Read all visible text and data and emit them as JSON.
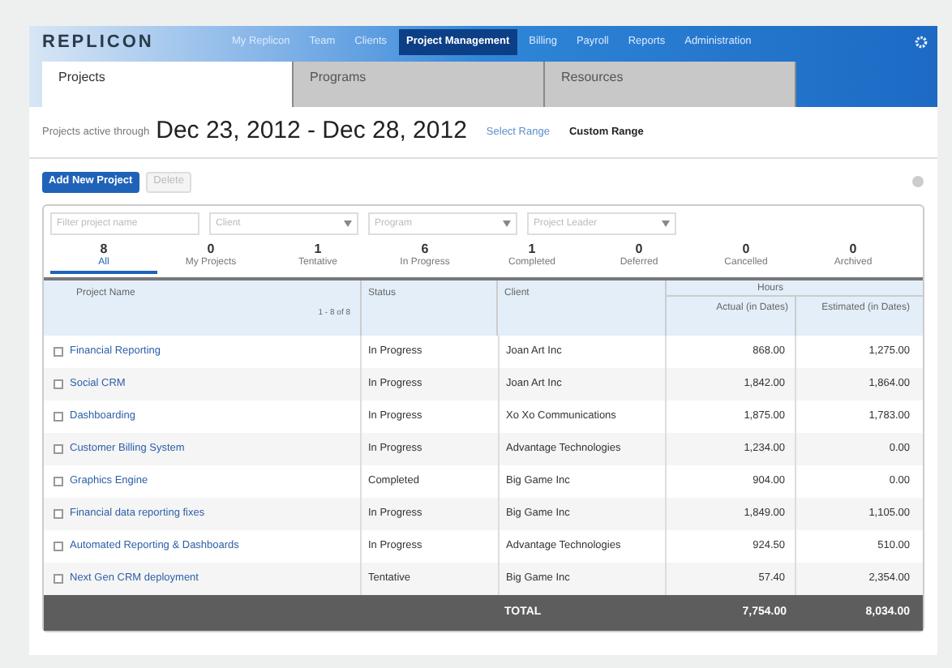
{
  "logo": "REPLICON",
  "nav": [
    {
      "label": "My Replicon",
      "selected": false
    },
    {
      "label": "Team",
      "selected": false
    },
    {
      "label": "Clients",
      "selected": false
    },
    {
      "label": "Project Management",
      "selected": true
    },
    {
      "label": "Billing",
      "selected": false
    },
    {
      "label": "Payroll",
      "selected": false
    },
    {
      "label": "Reports",
      "selected": false
    },
    {
      "label": "Administration",
      "selected": false
    }
  ],
  "tabs": [
    {
      "label": "Projects",
      "selected": true
    },
    {
      "label": "Programs",
      "selected": false
    },
    {
      "label": "Resources",
      "selected": false
    }
  ],
  "date_range": {
    "label": "Projects active through",
    "range": "Dec 23, 2012 - Dec 28, 2012",
    "links": [
      "Select Range",
      "Custom Range"
    ]
  },
  "actions": [
    {
      "label": "Add New Project",
      "disabled": false
    },
    {
      "label": "Delete",
      "disabled": true
    }
  ],
  "filters": [
    {
      "kind": "text",
      "placeholder": "Filter project name"
    },
    {
      "kind": "select",
      "placeholder": "Client"
    },
    {
      "kind": "select",
      "placeholder": "Program"
    },
    {
      "kind": "select",
      "placeholder": "Project Leader"
    }
  ],
  "status_tabs": [
    {
      "count": "8",
      "label": "All",
      "selected": true
    },
    {
      "count": "0",
      "label": "My Projects",
      "selected": false
    },
    {
      "count": "1",
      "label": "Tentative",
      "selected": false
    },
    {
      "count": "6",
      "label": "In Progress",
      "selected": false
    },
    {
      "count": "1",
      "label": "Completed",
      "selected": false
    },
    {
      "count": "0",
      "label": "Deferred",
      "selected": false
    },
    {
      "count": "0",
      "label": "Cancelled",
      "selected": false
    },
    {
      "count": "0",
      "label": "Archived",
      "selected": false
    }
  ],
  "table": {
    "columns": [
      "Project Name",
      "Status",
      "Client",
      "Actual (in Dates)",
      "Estimated (in Dates)"
    ],
    "group_header": "Hours",
    "pager": "1 - 8 of 8",
    "rows": [
      {
        "checked": false,
        "name": "Financial Reporting",
        "status": "In Progress",
        "client": "Joan Art Inc",
        "actual": "868.00",
        "estimated": "1,275.00"
      },
      {
        "checked": false,
        "name": "Social CRM",
        "status": "In Progress",
        "client": "Joan Art Inc",
        "actual": "1,842.00",
        "estimated": "1,864.00"
      },
      {
        "checked": false,
        "name": "Dashboarding",
        "status": "In Progress",
        "client": "Xo Xo Communications",
        "actual": "1,875.00",
        "estimated": "1,783.00"
      },
      {
        "checked": false,
        "name": "Customer Billing System",
        "status": "In Progress",
        "client": "Advantage Technologies",
        "actual": "1,234.00",
        "estimated": "0.00"
      },
      {
        "checked": false,
        "name": "Graphics Engine",
        "status": "Completed",
        "client": "Big Game Inc",
        "actual": "904.00",
        "estimated": "0.00"
      },
      {
        "checked": false,
        "name": "Financial data reporting fixes",
        "status": "In Progress",
        "client": "Big Game Inc",
        "actual": "1,849.00",
        "estimated": "1,105.00"
      },
      {
        "checked": false,
        "name": "Automated Reporting & Dashboards",
        "status": "In Progress",
        "client": "Advantage Technologies",
        "actual": "924.50",
        "estimated": "510.00"
      },
      {
        "checked": false,
        "name": "Next Gen CRM deployment",
        "status": "Tentative",
        "client": "Big Game Inc",
        "actual": "57.40",
        "estimated": "2,354.00"
      }
    ],
    "total": {
      "label": "TOTAL",
      "actual": "7,754.00",
      "estimated": "8,034.00"
    }
  }
}
